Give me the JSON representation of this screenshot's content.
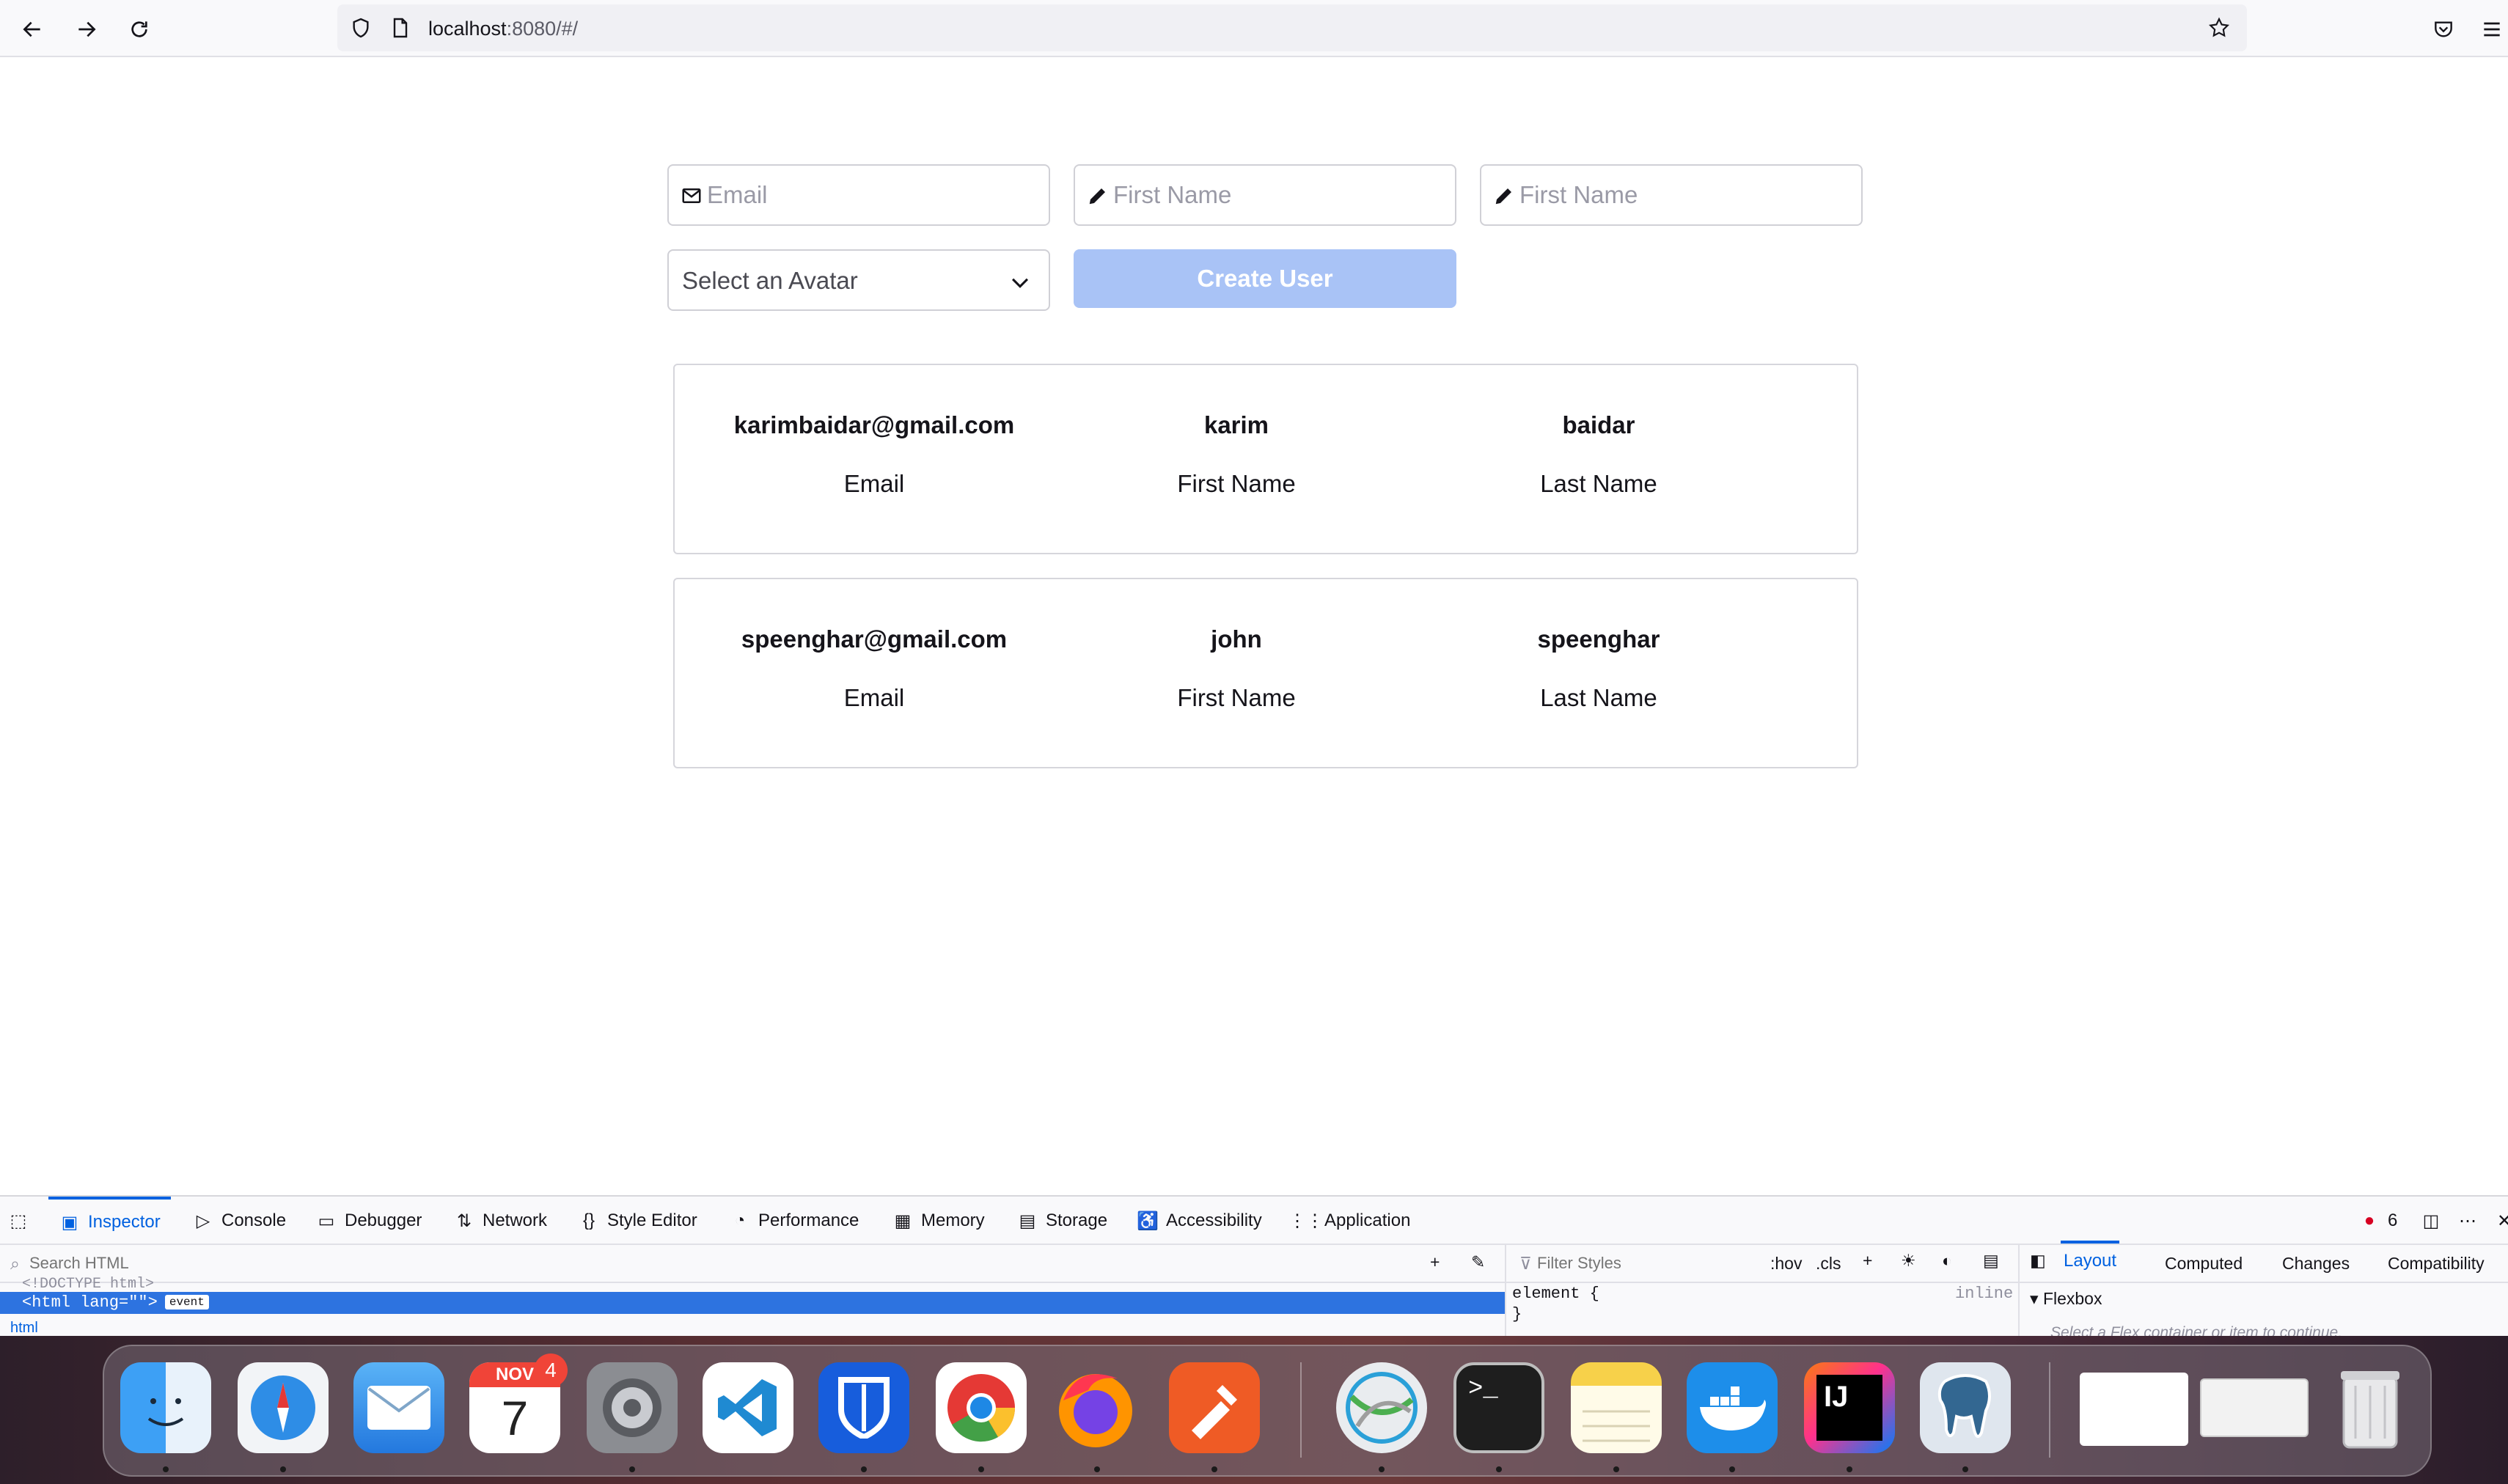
{
  "browser": {
    "url_host": "localhost",
    "url_rest": ":8080/#/"
  },
  "form": {
    "email_placeholder": "Email",
    "first_name_placeholder": "First Name",
    "last_name_placeholder": "First Name",
    "avatar_select_label": "Select an Avatar",
    "create_button_label": "Create User",
    "create_button_color": "#a9c3f6"
  },
  "users": [
    {
      "email": "karimbaidar@gmail.com",
      "first_name": "karim",
      "last_name": "baidar"
    },
    {
      "email": "speenghar@gmail.com",
      "first_name": "john",
      "last_name": "speenghar"
    }
  ],
  "card_labels": {
    "email": "Email",
    "first_name": "First Name",
    "last_name": "Last Name"
  },
  "devtools": {
    "tabs": [
      "Inspector",
      "Console",
      "Debugger",
      "Network",
      "Style Editor",
      "Performance",
      "Memory",
      "Storage",
      "Accessibility",
      "Application"
    ],
    "active_tab": "Inspector",
    "error_count": "6",
    "search_html_placeholder": "Search HTML",
    "filter_styles_placeholder": "Filter Styles",
    "hov_label": ":hov",
    "cls_label": ".cls",
    "doctype_line": "<!DOCTYPE html>",
    "html_line": "<html lang=\"\">",
    "event_badge": "event",
    "html_breadcrumb": "html",
    "element_rule": "element {",
    "element_rule_close": "}",
    "inline_label": "inline",
    "side_tabs": [
      "Layout",
      "Computed",
      "Changes",
      "Compatibility"
    ],
    "flexbox_label": "Flexbox",
    "flexbox_hint": "Select a Flex container or item to continue."
  },
  "dock": {
    "apps": [
      "finder",
      "safari",
      "mail",
      "calendar",
      "system-preferences",
      "vscode",
      "bitwarden",
      "chrome",
      "firefox",
      "postman",
      "cisco-anyconnect",
      "terminal",
      "notes",
      "docker",
      "intellij",
      "postgres"
    ],
    "calendar_month": "NOV",
    "calendar_day": "7",
    "calendar_badge": "4"
  }
}
